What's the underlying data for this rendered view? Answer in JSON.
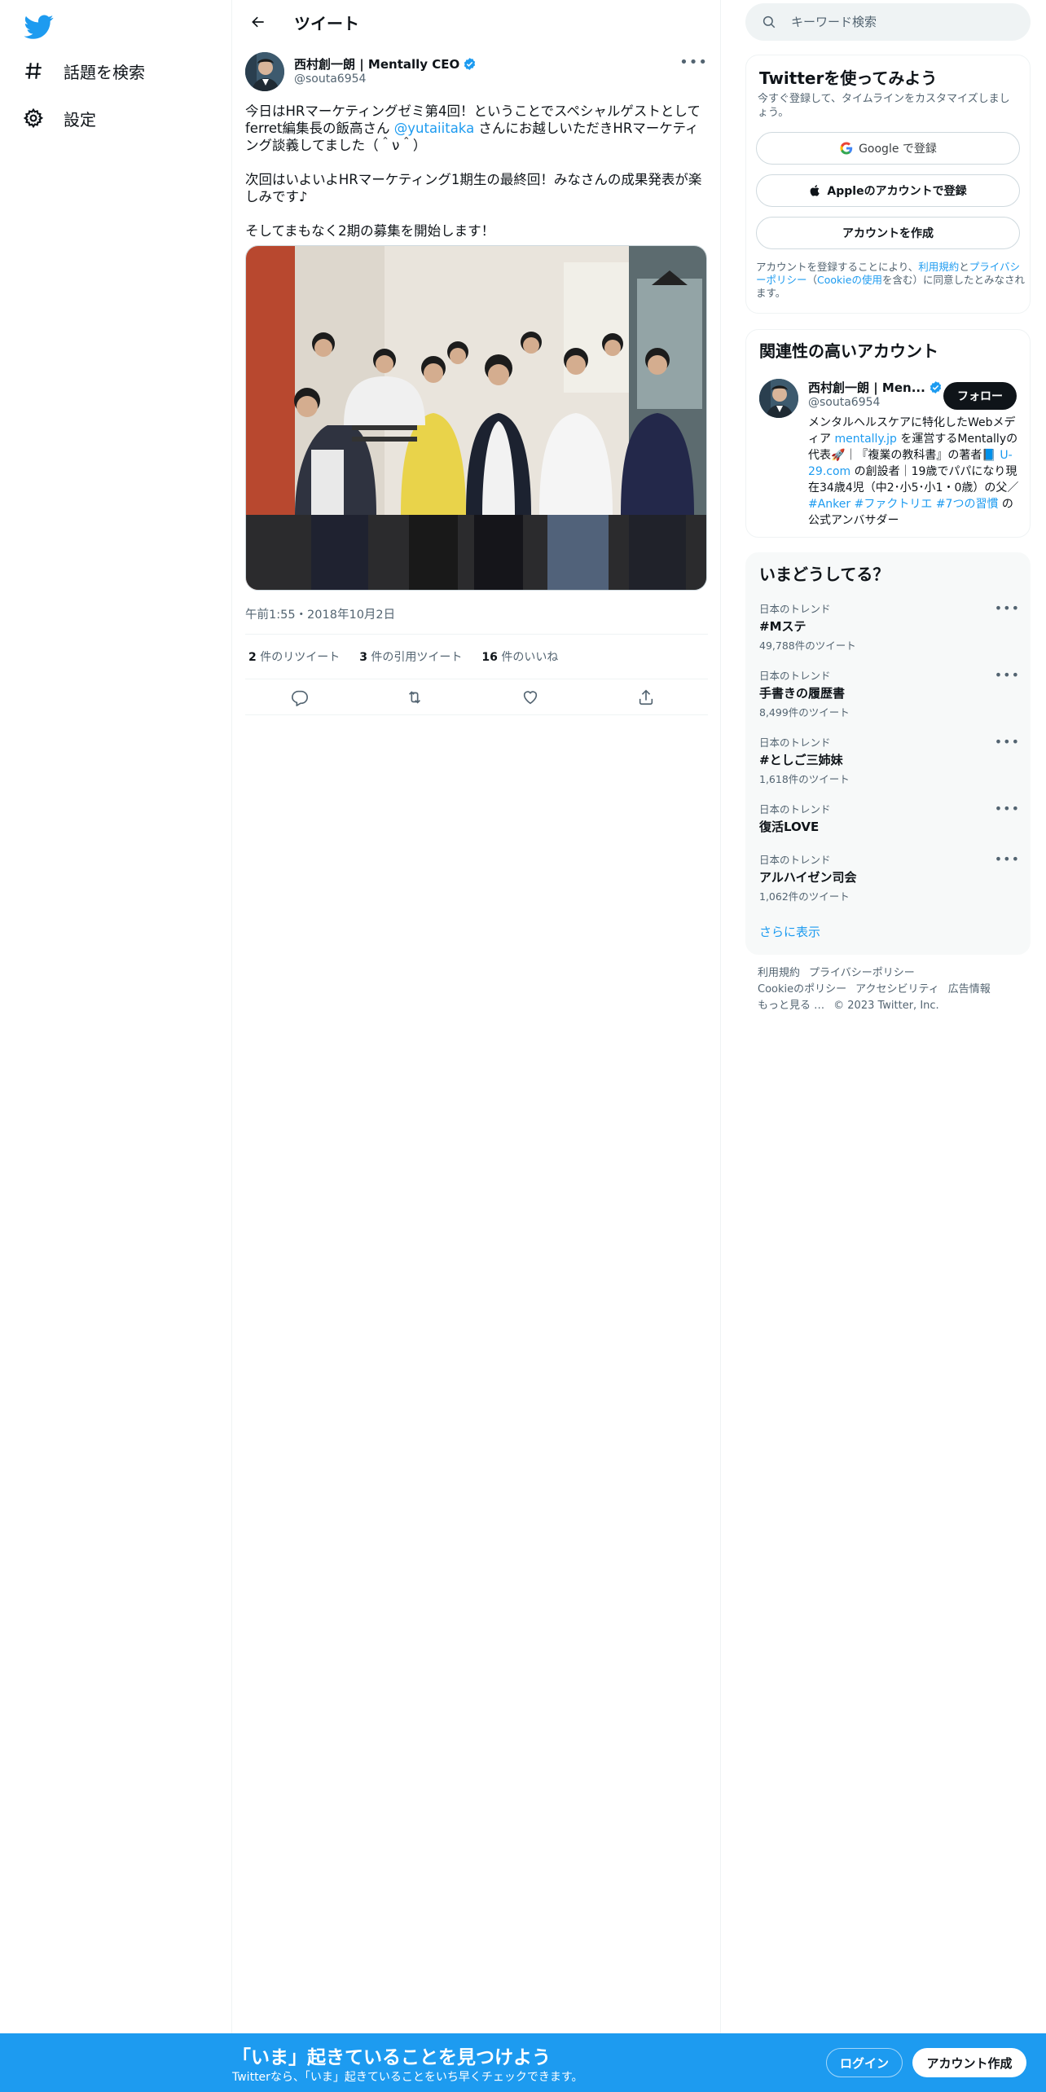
{
  "nav": {
    "items": [
      {
        "label": "話題を検索",
        "icon": "hashtag-icon"
      },
      {
        "label": "設定",
        "icon": "gear-icon"
      }
    ]
  },
  "header": {
    "title": "ツイート"
  },
  "tweet": {
    "author_name": "西村創一朗 | Mentally CEO",
    "author_handle": "@souta6954",
    "text_p1_before": "今日はHRマーケティングゼミ第4回！ということでスペシャルゲストとしてferret編集長の飯高さん ",
    "text_p1_mention": "@yutaiitaka",
    "text_p1_after": " さんにお越しいただきHRマーケティング談義してました（＾ν＾）",
    "text_p2": "次回はいよいよHRマーケティング1期生の最終回！みなさんの成果発表が楽しみです♪",
    "text_p3": "そしてまもなく2期の募集を開始します！",
    "timestamp": "午前1:55・2018年10月2日",
    "retweets_count": "2",
    "retweets_label": "件のリツイート",
    "quotes_count": "3",
    "quotes_label": "件の引用ツイート",
    "likes_count": "16",
    "likes_label": "件のいいね"
  },
  "search": {
    "placeholder": "キーワード検索"
  },
  "signup": {
    "title": "Twitterを使ってみよう",
    "subtitle": "今すぐ登録して、タイムラインをカスタマイズしましょう。",
    "google_label": "Google で登録",
    "apple_label": "Appleのアカウントで登録",
    "create_label": "アカウントを作成",
    "legal_1": "アカウントを登録することにより、",
    "legal_terms": "利用規約",
    "legal_2": "と",
    "legal_privacy": "プライバシーポリシー",
    "legal_3": "（",
    "legal_cookie": "Cookieの使用",
    "legal_4": "を含む）に同意したとみなされます。"
  },
  "relevant": {
    "title": "関連性の高いアカウント",
    "name": "西村創一朗 | Men...",
    "handle": "@souta6954",
    "follow_label": "フォロー",
    "bio_1": "メンタルヘルスケアに特化したWebメディア ",
    "bio_link1": "mentally.jp",
    "bio_2": " を運営するMentallyの代表🚀｜『複業の教科書』の著者📘 ",
    "bio_link2": "U-29.com",
    "bio_3": " の創設者｜19歳でパパになり現在34歳4児（中2･小5･小1・0歳）の父／ ",
    "bio_link3": "#Anker",
    "bio_4": " ",
    "bio_link4": "#ファクトリエ",
    "bio_5": " ",
    "bio_link5": "#7つの習慣",
    "bio_6": " の公式アンバサダー"
  },
  "trends": {
    "title": "いまどうしてる？",
    "items": [
      {
        "context": "日本のトレンド",
        "name": "#Mステ",
        "count": "49,788件のツイート"
      },
      {
        "context": "日本のトレンド",
        "name": "手書きの履歴書",
        "count": "8,499件のツイート"
      },
      {
        "context": "日本のトレンド",
        "name": "#としご三姉妹",
        "count": "1,618件のツイート"
      },
      {
        "context": "日本のトレンド",
        "name": "復活LOVE",
        "count": ""
      },
      {
        "context": "日本のトレンド",
        "name": "アルハイゼン司会",
        "count": "1,062件のツイート"
      }
    ],
    "show_more": "さらに表示"
  },
  "footer": {
    "links": [
      "利用規約",
      "プライバシーポリシー",
      "Cookieのポリシー",
      "アクセシビリティ",
      "広告情報",
      "もっと見る …"
    ],
    "copyright": "© 2023 Twitter, Inc."
  },
  "bottom_bar": {
    "title": "「いま」起きていることを見つけよう",
    "subtitle": "Twitterなら、「いま」起きていることをいち早くチェックできます。",
    "login_label": "ログイン",
    "signup_label": "アカウント作成"
  },
  "colors": {
    "accent": "#1d9bf0",
    "text": "#0f1419",
    "muted": "#536471"
  }
}
